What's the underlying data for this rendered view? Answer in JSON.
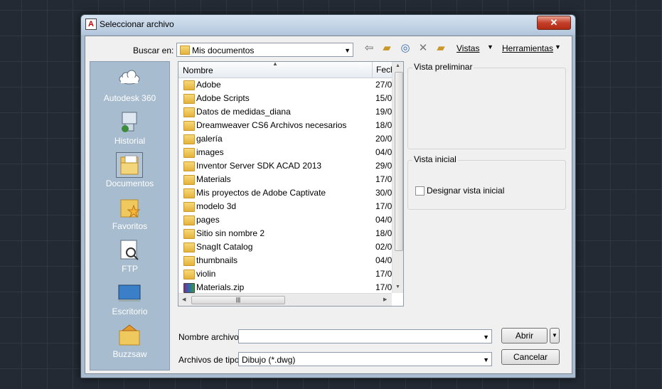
{
  "window": {
    "title": "Seleccionar archivo",
    "close_label": "✕"
  },
  "toolbar": {
    "lookin_label": "Buscar en:",
    "lookin_value": "Mis documentos",
    "views_label": "Vistas",
    "tools_label": "Herramientas"
  },
  "places": [
    {
      "label": "Autodesk 360",
      "icon": "cloud-icon"
    },
    {
      "label": "Historial",
      "icon": "history-icon"
    },
    {
      "label": "Documentos",
      "icon": "documents-folder-icon"
    },
    {
      "label": "Favoritos",
      "icon": "favorites-folder-icon"
    },
    {
      "label": "FTP",
      "icon": "ftp-icon"
    },
    {
      "label": "Escritorio",
      "icon": "desktop-icon"
    },
    {
      "label": "Buzzsaw",
      "icon": "buzzsaw-icon"
    }
  ],
  "filelist": {
    "col_name": "Nombre",
    "col_date": "Fech",
    "rows": [
      {
        "name": "Adobe",
        "date": "27/0"
      },
      {
        "name": "Adobe Scripts",
        "date": "15/0"
      },
      {
        "name": "Datos de medidas_diana",
        "date": "19/0"
      },
      {
        "name": "Dreamweaver CS6 Archivos necesarios",
        "date": "18/0"
      },
      {
        "name": "galería",
        "date": "20/0"
      },
      {
        "name": "images",
        "date": "04/0"
      },
      {
        "name": "Inventor Server SDK ACAD 2013",
        "date": "29/0"
      },
      {
        "name": "Materials",
        "date": "17/0"
      },
      {
        "name": "Mis proyectos de Adobe Captivate",
        "date": "30/0"
      },
      {
        "name": "modelo 3d",
        "date": "17/0"
      },
      {
        "name": "pages",
        "date": "04/0"
      },
      {
        "name": "Sitio sin nombre 2",
        "date": "18/0"
      },
      {
        "name": "SnagIt Catalog",
        "date": "02/0"
      },
      {
        "name": "thumbnails",
        "date": "04/0"
      },
      {
        "name": "violin",
        "date": "17/0"
      },
      {
        "name": "Materials.zip",
        "date": "17/0"
      }
    ]
  },
  "preview": {
    "title": "Vista preliminar"
  },
  "initial_view": {
    "title": "Vista inicial",
    "checkbox_label": "Designar vista inicial"
  },
  "bottom": {
    "filename_label": "Nombre archivo:",
    "filename_value": "",
    "filetype_label": "Archivos de tipo:",
    "filetype_value": "Dibujo (*.dwg)",
    "open_label": "Abrir",
    "cancel_label": "Cancelar"
  }
}
